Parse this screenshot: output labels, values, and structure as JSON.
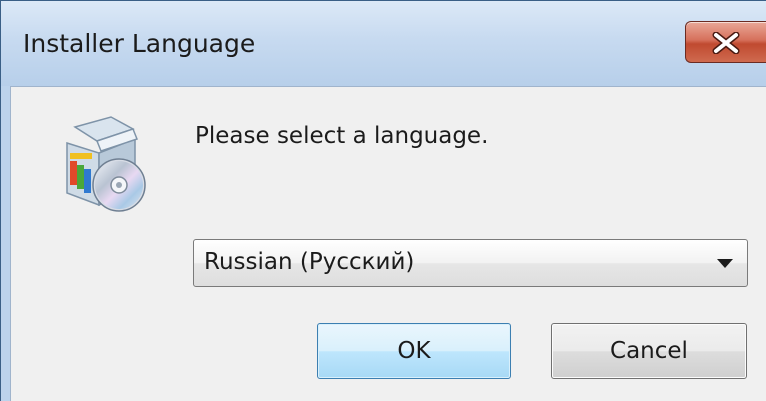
{
  "window": {
    "title": "Installer Language",
    "close_icon": "close-icon"
  },
  "dialog": {
    "icon": "installer-box-cd-icon",
    "prompt": "Please select a language.",
    "language_select": {
      "selected": "Russian (Русский)"
    },
    "ok_label": "OK",
    "cancel_label": "Cancel"
  },
  "colors": {
    "titlebar": "#c7daf0",
    "close_button": "#c9563c",
    "client_bg": "#f0f0f0",
    "ok_border": "#3c7fb1"
  }
}
